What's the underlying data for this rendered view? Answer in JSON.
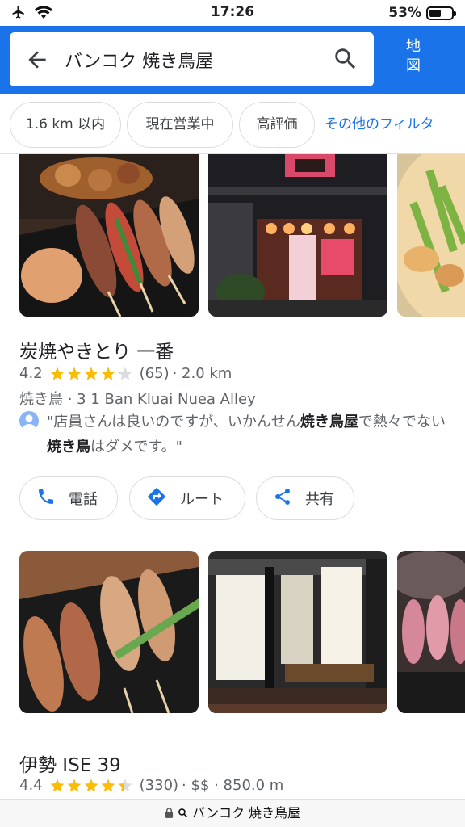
{
  "status_bar": {
    "time": "17:26",
    "battery": "53%",
    "battery_level": 0.53
  },
  "search": {
    "query": "バンコク 焼き鳥屋",
    "map_button": [
      "地",
      "図"
    ]
  },
  "filters": {
    "chips": [
      "1.6 km 以内",
      "現在営業中",
      "高評価"
    ],
    "more": "その他のフィルタ"
  },
  "results": [
    {
      "name": "炭焼やきとり 一番",
      "rating": "4.2",
      "stars": 4.2,
      "reviews": "(65)",
      "distance": "· 2.0 km",
      "category": "焼き鳥 · 3 1 Ban Kluai Nuea Alley",
      "review_parts": [
        "\"店員さんは良いのですが、いかんせん",
        "焼き鳥屋",
        "で熱々でない",
        "焼き鳥",
        "はダメです。\""
      ]
    },
    {
      "name": "伊勢 ISE 39",
      "rating": "4.4",
      "stars": 4.4,
      "reviews": "(330)",
      "distance": "· $$ · 850.0 m"
    }
  ],
  "actions": {
    "call": "電話",
    "route": "ルート",
    "share": "共有"
  },
  "url_bar": {
    "text": "バンコク 焼き鳥屋"
  },
  "colors": {
    "accent": "#1a73e8",
    "star": "#fbbc04"
  }
}
